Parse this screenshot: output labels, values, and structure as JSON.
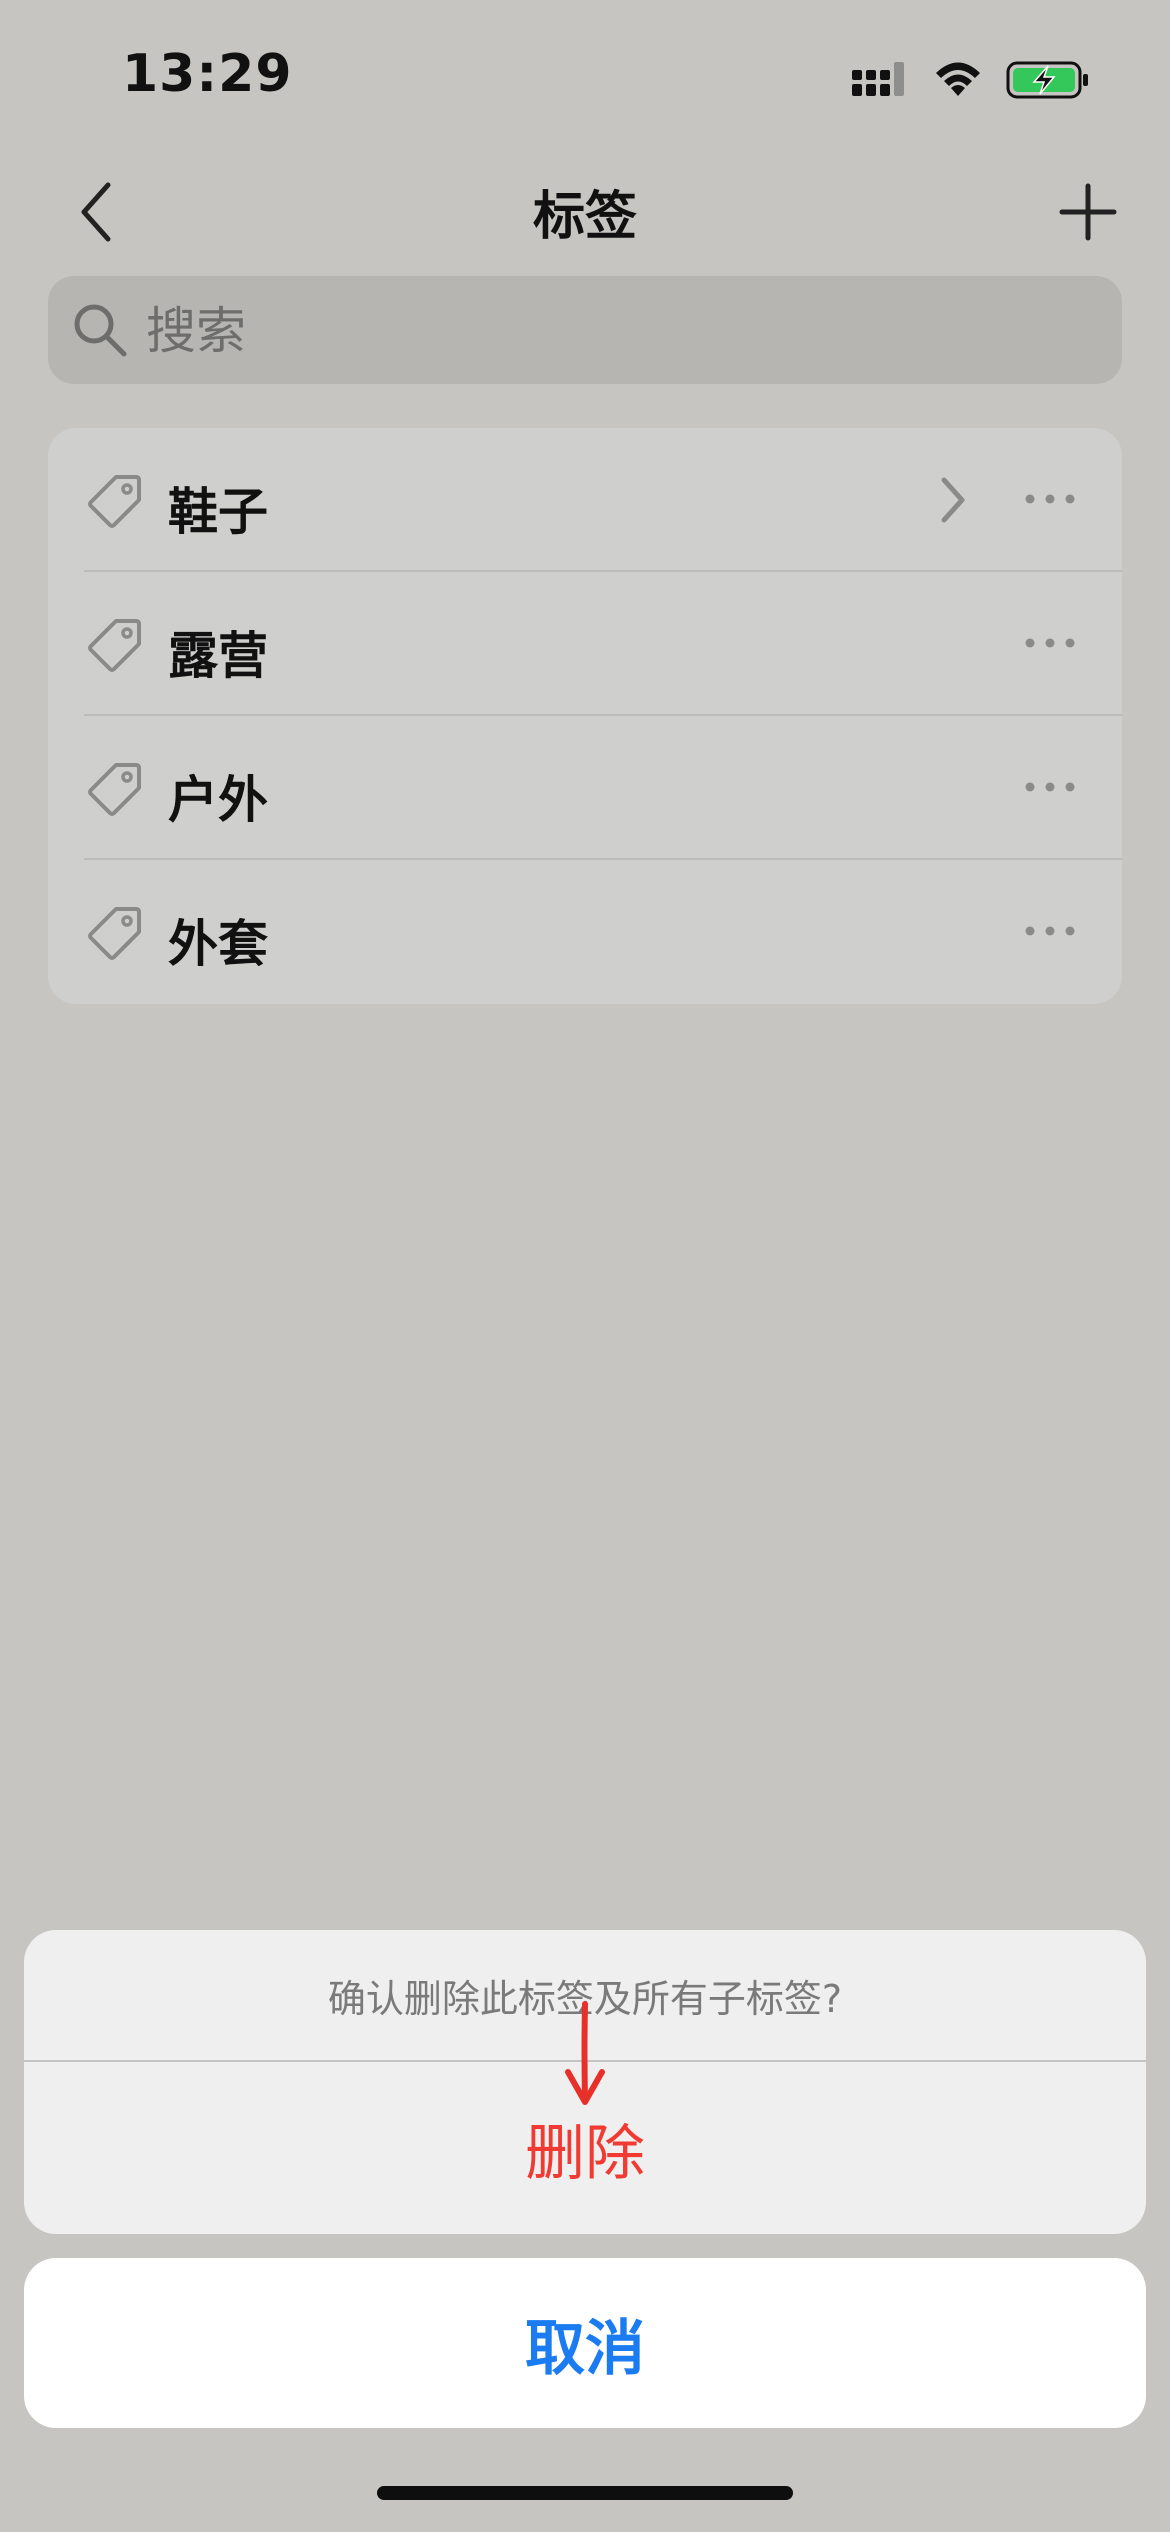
{
  "status_bar": {
    "time": "13:29",
    "icons": [
      "signal-icon",
      "wifi-icon",
      "battery-charging-icon"
    ],
    "battery_color": "#34c759"
  },
  "nav": {
    "title": "标签",
    "back_icon": "chevron-left-icon",
    "add_icon": "plus-icon"
  },
  "search": {
    "placeholder": "搜索",
    "icon": "search-icon"
  },
  "tags": [
    {
      "label": "鞋子",
      "has_children": true
    },
    {
      "label": "露营",
      "has_children": false
    },
    {
      "label": "户外",
      "has_children": false
    },
    {
      "label": "外套",
      "has_children": false
    }
  ],
  "action_sheet": {
    "message": "确认删除此标签及所有子标签?",
    "delete_label": "删除",
    "cancel_label": "取消",
    "delete_color": "#f03a32",
    "cancel_color": "#1a7cf0"
  }
}
